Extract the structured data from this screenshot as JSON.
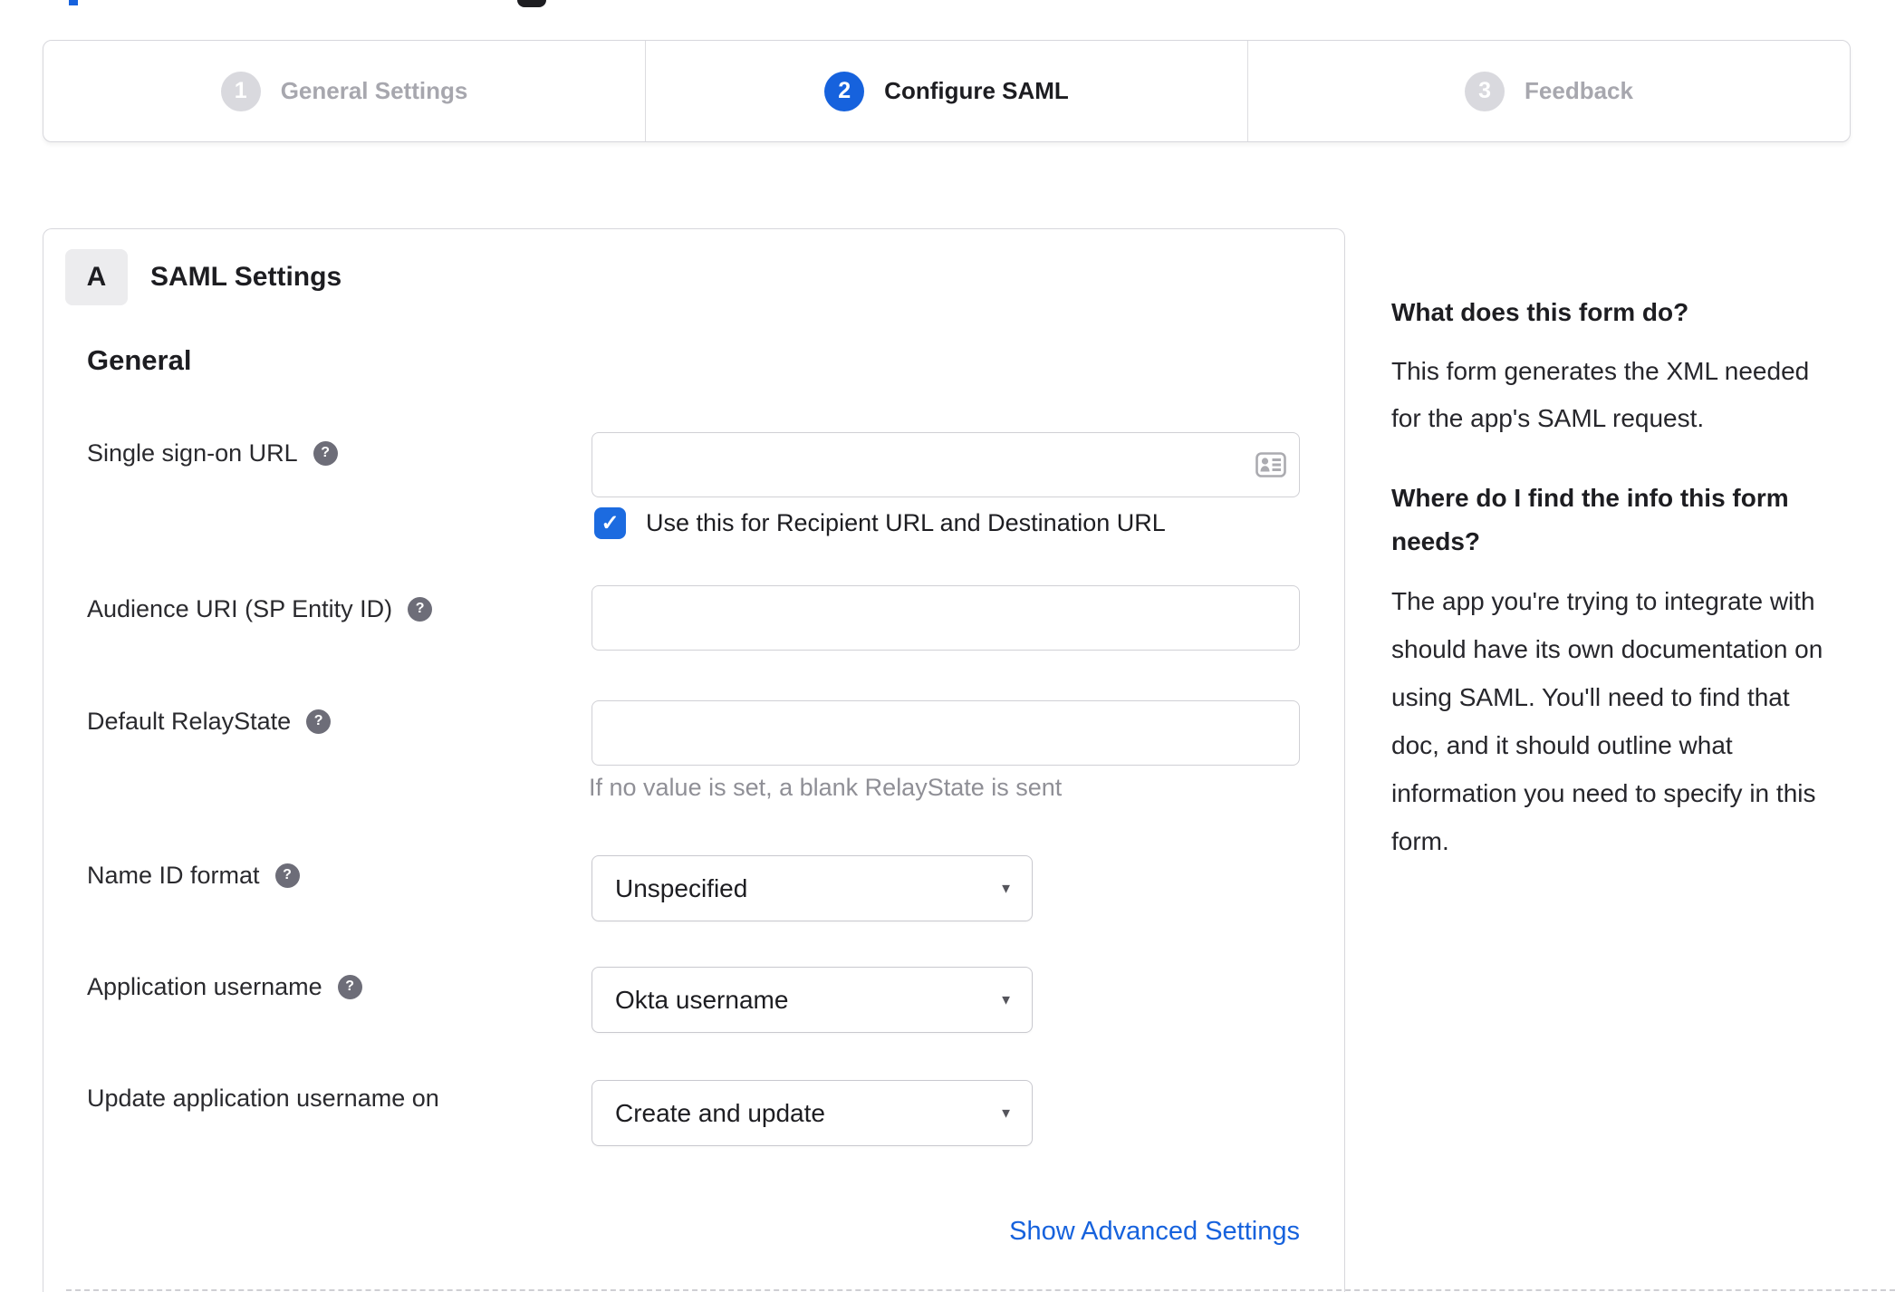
{
  "colors": {
    "accent_blue": "#1662dd",
    "checkbox_blue": "#1c6be0",
    "border_gray": "#d7d7dc",
    "inactive_step_text": "#a7a7ae",
    "inactive_step_circle": "#d9d9de",
    "hint_gray": "#8f8f96",
    "badge_bg": "#ececee",
    "help_icon_bg": "#6d6d78"
  },
  "icons": {
    "help_glyph": "?",
    "checkmark_glyph": "✓",
    "dropdown_arrow_glyph": "▼"
  },
  "stepper": {
    "steps": [
      {
        "number": "1",
        "label": "General Settings",
        "active": false
      },
      {
        "number": "2",
        "label": "Configure SAML",
        "active": true
      },
      {
        "number": "3",
        "label": "Feedback",
        "active": false
      }
    ]
  },
  "saml_panel": {
    "badge": "A",
    "title": "SAML Settings",
    "section_heading": "General",
    "fields": {
      "sso": {
        "label": "Single sign-on URL",
        "value": "",
        "checkbox_label": "Use this for Recipient URL and Destination URL",
        "checkbox_checked": true
      },
      "audience": {
        "label": "Audience URI (SP Entity ID)",
        "value": ""
      },
      "relay": {
        "label": "Default RelayState",
        "value": "",
        "hint": "If no value is set, a blank RelayState is sent"
      },
      "name_id": {
        "label": "Name ID format",
        "value": "Unspecified"
      },
      "app_username": {
        "label": "Application username",
        "value": "Okta username"
      },
      "update_username": {
        "label": "Update application username on",
        "value": "Create and update"
      }
    },
    "advanced_link": "Show Advanced Settings"
  },
  "help": {
    "q1": "What does this form do?",
    "a1_lines": [
      "This form generates the XML needed",
      "for the app's SAML request."
    ],
    "q2_lines": [
      "Where do I find the info this form",
      "needs?"
    ],
    "a2_lines": [
      "The app you're trying to integrate with",
      "should have its own documentation on",
      "using SAML. You'll need to find that",
      "doc, and it should outline what",
      "information you need to specify in this",
      "form."
    ]
  }
}
